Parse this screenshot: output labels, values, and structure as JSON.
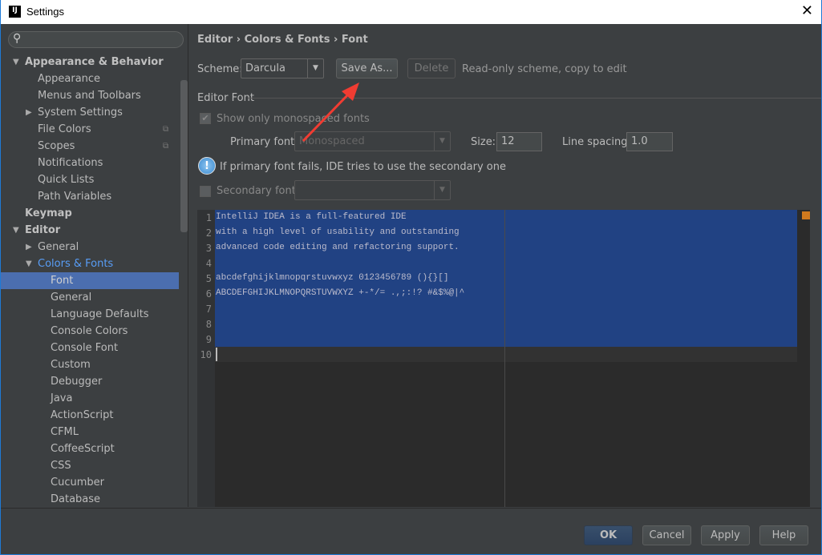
{
  "window": {
    "title": "Settings",
    "logo": "IJ"
  },
  "sidebar": {
    "search_placeholder": "",
    "items": [
      {
        "label": "Appearance & Behavior",
        "level": 0,
        "bold": true,
        "arrow": "down"
      },
      {
        "label": "Appearance",
        "level": 1
      },
      {
        "label": "Menus and Toolbars",
        "level": 1
      },
      {
        "label": "System Settings",
        "level": 1,
        "arrow": "right"
      },
      {
        "label": "File Colors",
        "level": 1,
        "copy": true
      },
      {
        "label": "Scopes",
        "level": 1,
        "copy": true
      },
      {
        "label": "Notifications",
        "level": 1
      },
      {
        "label": "Quick Lists",
        "level": 1
      },
      {
        "label": "Path Variables",
        "level": 1
      },
      {
        "label": "Keymap",
        "level": 0,
        "bold": true
      },
      {
        "label": "Editor",
        "level": 0,
        "bold": true,
        "arrow": "down"
      },
      {
        "label": "General",
        "level": 1,
        "arrow": "right"
      },
      {
        "label": "Colors & Fonts",
        "level": 1,
        "arrow": "down",
        "highlight": true
      },
      {
        "label": "Font",
        "level": 2,
        "selected": true
      },
      {
        "label": "General",
        "level": 2
      },
      {
        "label": "Language Defaults",
        "level": 2
      },
      {
        "label": "Console Colors",
        "level": 2
      },
      {
        "label": "Console Font",
        "level": 2
      },
      {
        "label": "Custom",
        "level": 2
      },
      {
        "label": "Debugger",
        "level": 2
      },
      {
        "label": "Java",
        "level": 2
      },
      {
        "label": "ActionScript",
        "level": 2
      },
      {
        "label": "CFML",
        "level": 2
      },
      {
        "label": "CoffeeScript",
        "level": 2
      },
      {
        "label": "CSS",
        "level": 2
      },
      {
        "label": "Cucumber",
        "level": 2
      },
      {
        "label": "Database",
        "level": 2
      }
    ]
  },
  "breadcrumb": "Editor › Colors & Fonts › Font",
  "scheme": {
    "label": "Scheme:",
    "value": "Darcula",
    "save_as": "Save As...",
    "delete": "Delete",
    "note": "Read-only scheme, copy to edit"
  },
  "editor_font": {
    "section": "Editor Font",
    "mono_only": "Show only monospaced fonts",
    "mono_only_checked": true,
    "primary_label": "Primary font:",
    "primary_value": "Monospaced",
    "size_label": "Size:",
    "size_value": "12",
    "spacing_label": "Line spacing:",
    "spacing_value": "1.0",
    "info": "If primary font fails, IDE tries to use the secondary one",
    "secondary_label": "Secondary font:",
    "secondary_value": "",
    "secondary_checked": false
  },
  "preview": {
    "lines": [
      "IntelliJ IDEA is a full-featured IDE",
      "with a high level of usability and outstanding",
      "advanced code editing and refactoring support.",
      "",
      "abcdefghijklmnopqrstuvwxyz 0123456789 (){}[]",
      "ABCDEFGHIJKLMNOPQRSTUVWXYZ +-*/= .,;:!? #&$%@|^",
      "",
      "",
      "",
      ""
    ]
  },
  "buttons": {
    "ok": "OK",
    "cancel": "Cancel",
    "apply": "Apply",
    "help": "Help"
  },
  "colors": {
    "accent": "#4b6eaf",
    "selection": "#214283",
    "annotation_arrow": "#f03c32"
  }
}
